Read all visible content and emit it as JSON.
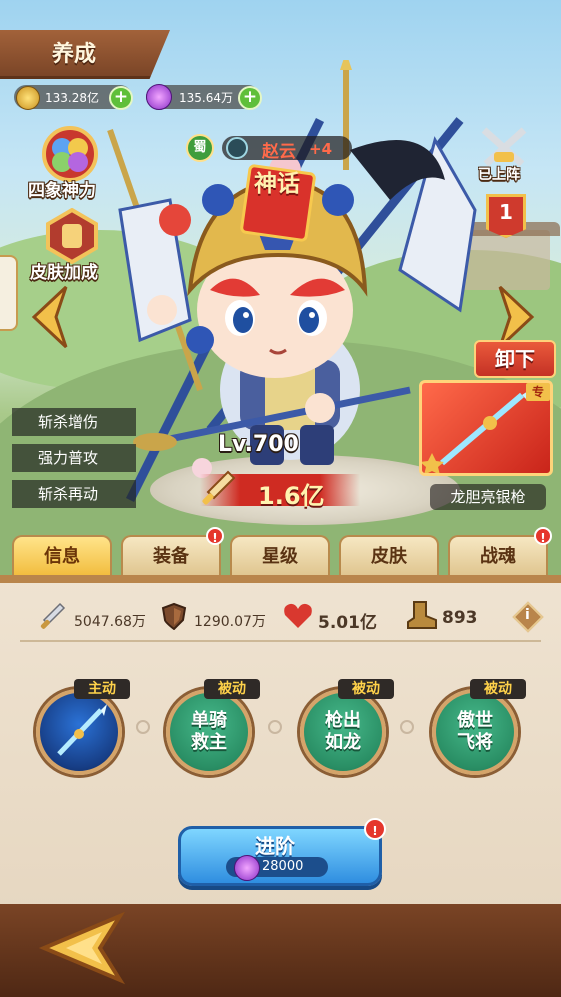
{
  "header": {
    "title": "养成",
    "gold": "133.28亿",
    "gem": "135.64万"
  },
  "left_menu": {
    "four_symbols": "四象神力",
    "skin_bonus": "皮肤加成"
  },
  "hero": {
    "faction": "蜀",
    "name": "赵云",
    "plus": "+4",
    "rarity": "神话",
    "level": "Lv.700",
    "power": "1.6亿"
  },
  "right_panel": {
    "deployed": "已上阵",
    "slot": "1",
    "unequip": "卸下",
    "exclusive_tag": "专",
    "weapon_name": "龙胆亮银枪"
  },
  "buffs": [
    "斩杀增伤",
    "强力普攻",
    "斩杀再动"
  ],
  "tabs": [
    {
      "label": "信息",
      "active": true,
      "badge": false
    },
    {
      "label": "装备",
      "active": false,
      "badge": true
    },
    {
      "label": "星级",
      "active": false,
      "badge": false
    },
    {
      "label": "皮肤",
      "active": false,
      "badge": false
    },
    {
      "label": "战魂",
      "active": false,
      "badge": true
    }
  ],
  "stats": {
    "attack": "5047.68万",
    "defense": "1290.07万",
    "hp": "5.01亿",
    "speed": "893"
  },
  "skills": [
    {
      "tag": "主动",
      "name": ""
    },
    {
      "tag": "被动",
      "name": "单骑\n救主"
    },
    {
      "tag": "被动",
      "name": "枪出\n如龙"
    },
    {
      "tag": "被动",
      "name": "傲世\n飞将"
    }
  ],
  "advance": {
    "label": "进阶",
    "cost": "28000"
  },
  "colors": {
    "accent_gold": "#f2bd3f",
    "skill_green": "#2a8f65",
    "badge_red": "#e5362c"
  }
}
